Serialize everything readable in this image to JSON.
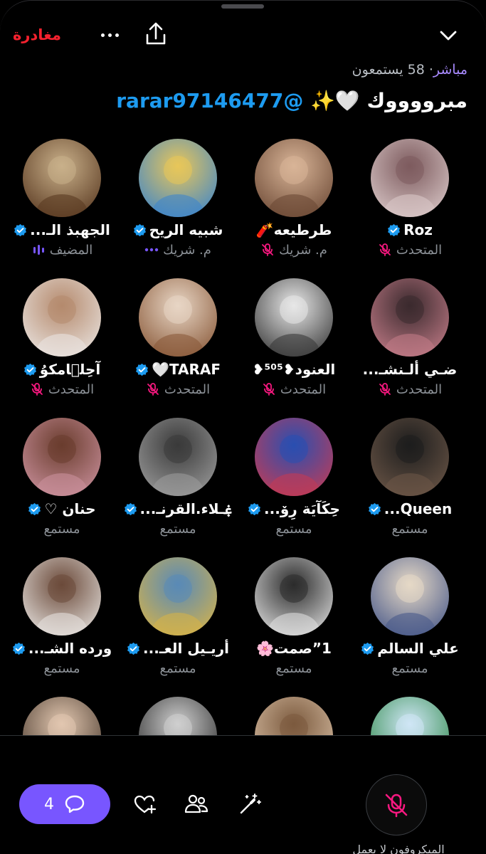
{
  "header": {
    "leave_label": "مغادرة"
  },
  "space": {
    "live_label": "مباشر",
    "separator": "·",
    "listeners_text": "58 يستمعون",
    "title_handle": "@rarar97146477",
    "title_text": "مبرووووك 🤍✨"
  },
  "participants": [
    {
      "name": "الجهبذ الـ...",
      "role": "المضيف",
      "verified": true,
      "indicator": "speaking-bars"
    },
    {
      "name": "شبيه الريح",
      "role": "م. شريك",
      "verified": true,
      "indicator": "dots"
    },
    {
      "name": "طرطيعه🧨",
      "role": "م. شريك",
      "verified": false,
      "indicator": "mic-off"
    },
    {
      "name": "Roz",
      "role": "المتحدث",
      "verified": true,
      "indicator": "mic-off"
    },
    {
      "name": "آحِلۤامكوُ",
      "role": "المتحدث",
      "verified": true,
      "indicator": "mic-off"
    },
    {
      "name": "TARAF🤍",
      "role": "المتحدث",
      "verified": true,
      "indicator": "mic-off"
    },
    {
      "name": "العنود❥⁵⁰⁵❥",
      "role": "المتحدث",
      "verified": false,
      "indicator": "mic-off"
    },
    {
      "name": "ضـي ألـنشـ...",
      "role": "المتحدث",
      "verified": false,
      "indicator": "mic-off"
    },
    {
      "name": "حنان ♡",
      "role": "مستمع",
      "verified": true,
      "indicator": "none"
    },
    {
      "name": "ۼـلاء.القرنـ...",
      "role": "مستمع",
      "verified": true,
      "indicator": "none"
    },
    {
      "name": "حِكَآيَة رِۆ...",
      "role": "مستمع",
      "verified": true,
      "indicator": "none"
    },
    {
      "name": "Queen...",
      "role": "مستمع",
      "verified": true,
      "indicator": "none"
    },
    {
      "name": "ورده الشـ...",
      "role": "مستمع",
      "verified": true,
      "indicator": "none"
    },
    {
      "name": "أريـيل العـ...",
      "role": "مستمع",
      "verified": true,
      "indicator": "none"
    },
    {
      "name": "1”صمت🌸",
      "role": "مستمع",
      "verified": false,
      "indicator": "none"
    },
    {
      "name": "علي السالم",
      "role": "مستمع",
      "verified": true,
      "indicator": "none"
    },
    {
      "name": "",
      "role": "",
      "verified": false,
      "indicator": "none"
    },
    {
      "name": "",
      "role": "",
      "verified": false,
      "indicator": "none"
    },
    {
      "name": "",
      "role": "",
      "verified": false,
      "indicator": "none"
    },
    {
      "name": "",
      "role": "",
      "verified": false,
      "indicator": "none"
    }
  ],
  "avatar_colors": [
    [
      "#5a3a22",
      "#c9b08a"
    ],
    [
      "#3f86c9",
      "#e8c65a"
    ],
    [
      "#6d4a36",
      "#d8b497"
    ],
    [
      "#d9c7c7",
      "#7d5b5e"
    ],
    [
      "#e9e3df",
      "#b58a6d"
    ],
    [
      "#8a5a3a",
      "#e8d6c5"
    ],
    [
      "#3a3a3a",
      "#e8e8e8"
    ],
    [
      "#c07a86",
      "#3b2a2e"
    ],
    [
      "#c98f9b",
      "#6a3d2e"
    ],
    [
      "#9a9a9a",
      "#3a3a3a"
    ],
    [
      "#c23b55",
      "#2a4fb0"
    ],
    [
      "#6a5546",
      "#1d1d1d"
    ],
    [
      "#e4e0dc",
      "#6b4a3a"
    ],
    [
      "#d4b24a",
      "#5a8ab6"
    ],
    [
      "#dcdcdc",
      "#2b2b2b"
    ],
    [
      "#4a5a8a",
      "#e6d9c6"
    ],
    [
      "#4a3a2e",
      "#e2c7b0"
    ],
    [
      "#2b2b2b",
      "#cfcfcf"
    ],
    [
      "#d9c0a6",
      "#7b5a3e"
    ],
    [
      "#2f8a4a",
      "#cfe6f5"
    ]
  ],
  "bottom_bar": {
    "chat_count": "4",
    "mic_note": "الميكروفون لا يعمل"
  },
  "colors": {
    "accent_red": "#f4212e",
    "accent_purple": "#7856ff",
    "verified_blue": "#1d9bf0",
    "muted_pink": "#f91880",
    "secondary_text": "#8b9096"
  }
}
